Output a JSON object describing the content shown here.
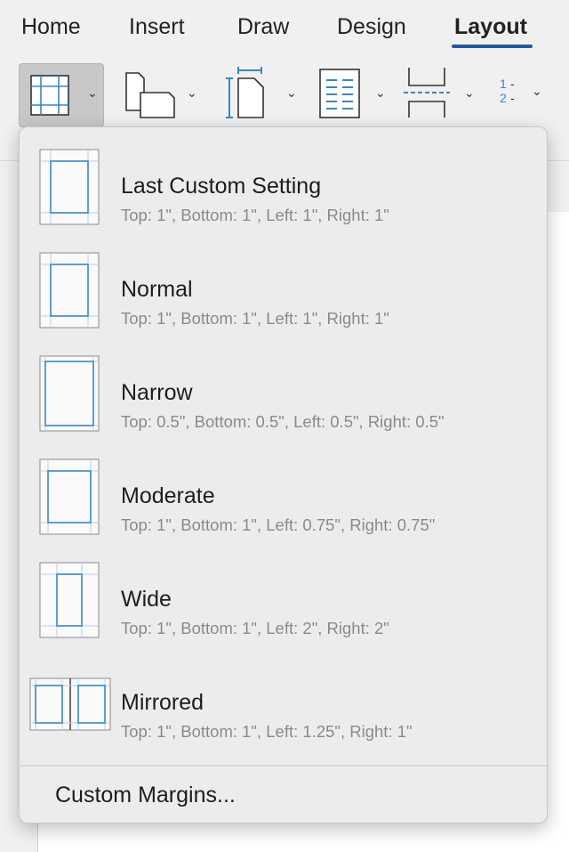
{
  "tabs": [
    {
      "label": "Home"
    },
    {
      "label": "Insert"
    },
    {
      "label": "Draw"
    },
    {
      "label": "Design"
    },
    {
      "label": "Layout"
    }
  ],
  "ribbon": {
    "icons": [
      "margins-icon",
      "orientation-icon",
      "size-icon",
      "columns-icon",
      "breaks-icon",
      "line-numbers-icon"
    ],
    "line_numbers_glyph_1": "1",
    "line_numbers_glyph_2": "2"
  },
  "margins_menu": {
    "items": [
      {
        "title": "Last Custom Setting",
        "detail": "Top: 1\", Bottom: 1\", Left: 1\", Right: 1\""
      },
      {
        "title": "Normal",
        "detail": "Top: 1\", Bottom: 1\", Left: 1\", Right: 1\""
      },
      {
        "title": "Narrow",
        "detail": "Top: 0.5\", Bottom: 0.5\", Left: 0.5\", Right: 0.5\""
      },
      {
        "title": "Moderate",
        "detail": "Top: 1\", Bottom: 1\", Left: 0.75\", Right: 0.75\""
      },
      {
        "title": "Wide",
        "detail": "Top: 1\", Bottom: 1\", Left: 2\", Right: 2\""
      },
      {
        "title": "Mirrored",
        "detail": "Top: 1\", Bottom: 1\", Left: 1.25\", Right: 1\""
      }
    ],
    "custom_label": "Custom Margins..."
  },
  "colors": {
    "accent": "#2b579a",
    "margin_line": "#3a86c8",
    "guide_line": "#b9cfe6"
  }
}
